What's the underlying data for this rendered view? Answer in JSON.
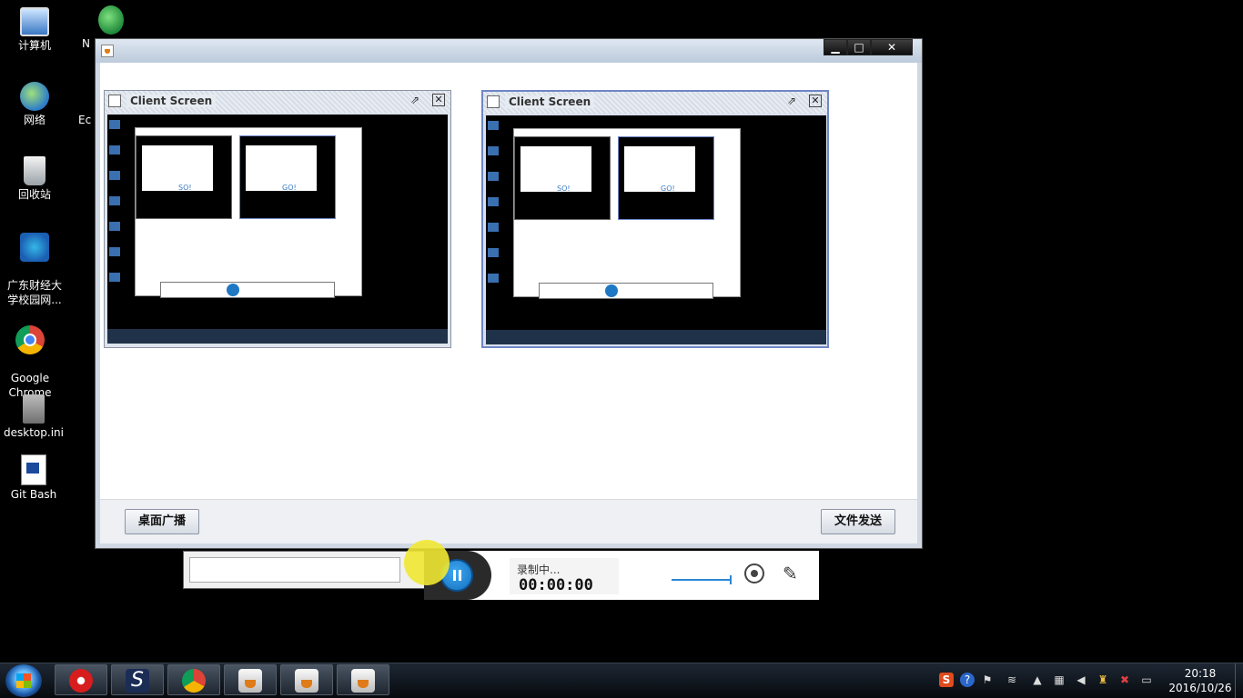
{
  "desktop": {
    "icons": [
      {
        "label": "计算机",
        "icon": "computer-icon"
      },
      {
        "label": "网络",
        "icon": "network-icon"
      },
      {
        "label": "回收站",
        "icon": "recycle-bin-icon"
      },
      {
        "label": "广东财经大\n学校园网...",
        "icon": "shortcut-icon"
      },
      {
        "label": "Google\nChrome",
        "icon": "chrome-icon"
      },
      {
        "label": "desktop.ini",
        "icon": "ini-file-icon"
      },
      {
        "label": "Git Bash",
        "icon": "git-bash-icon"
      },
      {
        "label": "N",
        "icon": "app-shortcut-icon"
      },
      {
        "label": "Ec",
        "icon": ""
      }
    ]
  },
  "main_window": {
    "controls": {
      "minimize": "▁",
      "maximize": "□",
      "close": "✕"
    },
    "client_screens": [
      {
        "title": "Client Screen",
        "mini_text": "SO!"
      },
      {
        "title": "Client Screen",
        "mini_text": "GO!"
      }
    ],
    "buttons": {
      "left": "桌面广播",
      "right": "文件发送"
    }
  },
  "recorder": {
    "status": "录制中...",
    "time": "00:00:00"
  },
  "taskbar": {
    "apps": [
      "netease-music-icon",
      "s-app-icon",
      "chrome-icon",
      "java-icon",
      "java-icon",
      "java-icon"
    ],
    "tray": [
      "sogou-icon",
      "help-icon",
      "flag-icon",
      "wifi-icon",
      "arrow-up-icon",
      "device-icon",
      "volume-icon",
      "user-icon",
      "network-block-icon",
      "monitor-icon"
    ],
    "time": "20:18",
    "date": "2016/10/26"
  },
  "colors": {
    "accent": "#1f78c4",
    "highlight": "#f0e832",
    "selected_frame": "#6f86c6"
  }
}
